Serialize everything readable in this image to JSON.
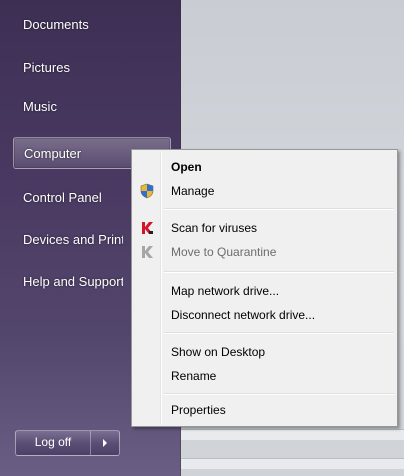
{
  "start_menu": {
    "items": [
      {
        "label": "Documents"
      },
      {
        "label": "Pictures"
      },
      {
        "label": "Music"
      },
      {
        "label": "Computer"
      },
      {
        "label": "Control Panel"
      },
      {
        "label": "Devices and Printers"
      },
      {
        "label": "Help and Support"
      }
    ],
    "logoff_label": "Log off"
  },
  "context_menu": {
    "items": [
      {
        "label": "Open",
        "bold": true,
        "icon": ""
      },
      {
        "label": "Manage",
        "icon": "uac-shield-icon"
      },
      {
        "label": "Scan for viruses",
        "icon": "antivirus-k-icon"
      },
      {
        "label": "Move to Quarantine",
        "icon": "antivirus-k-disabled-icon",
        "disabled": true
      },
      {
        "label": "Map network drive..."
      },
      {
        "label": "Disconnect network drive..."
      },
      {
        "label": "Show on Desktop"
      },
      {
        "label": "Rename"
      },
      {
        "label": "Properties"
      }
    ]
  },
  "colors": {
    "start_pane": "#4a3a63",
    "menu_bg": "#f0f0f0",
    "kaspersky_red": "#d4142a"
  }
}
